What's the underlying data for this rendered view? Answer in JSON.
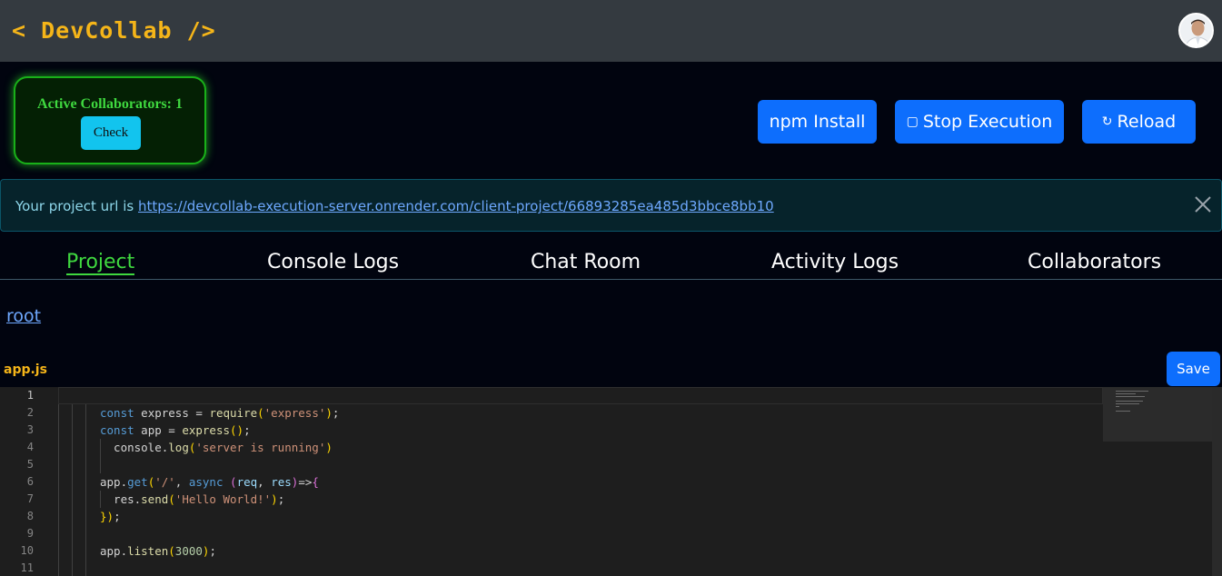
{
  "header": {
    "logo": "< DevCollab />"
  },
  "collaborators": {
    "label": "Active Collaborators: 1",
    "check_label": "Check"
  },
  "toolbar": {
    "npm_label": "npm Install",
    "stop_label": "Stop Execution",
    "reload_label": "Reload"
  },
  "alert": {
    "prefix": "Your project url is ",
    "url": "https://devcollab-execution-server.onrender.com/client-project/66893285ea485d3bbce8bb10"
  },
  "tabs": [
    {
      "label": "Project",
      "active": true
    },
    {
      "label": "Console Logs",
      "active": false
    },
    {
      "label": "Chat Room",
      "active": false
    },
    {
      "label": "Activity Logs",
      "active": false
    },
    {
      "label": "Collaborators",
      "active": false
    }
  ],
  "breadcrumb": {
    "root": "root"
  },
  "editor": {
    "file_name": "app.js",
    "save_label": "Save",
    "line_numbers": [
      "1",
      "2",
      "3",
      "4",
      "5",
      "6",
      "7",
      "8",
      "9",
      "10",
      "11"
    ],
    "lines": [
      "",
      "const express = require('express');",
      "const app = express();",
      "  console.log('server is running')",
      "",
      "app.get('/', async (req, res)=>{",
      "  res.send('Hello World!');",
      "});",
      "",
      "app.listen(3000);",
      ""
    ]
  },
  "colors": {
    "accent_yellow": "#f5b519",
    "accent_green": "#3fd83f",
    "primary_blue": "#0d6efd",
    "info_cyan": "#12c4ee"
  },
  "icons": {
    "stop": "square-icon",
    "reload": "refresh-icon",
    "close": "close-icon"
  }
}
